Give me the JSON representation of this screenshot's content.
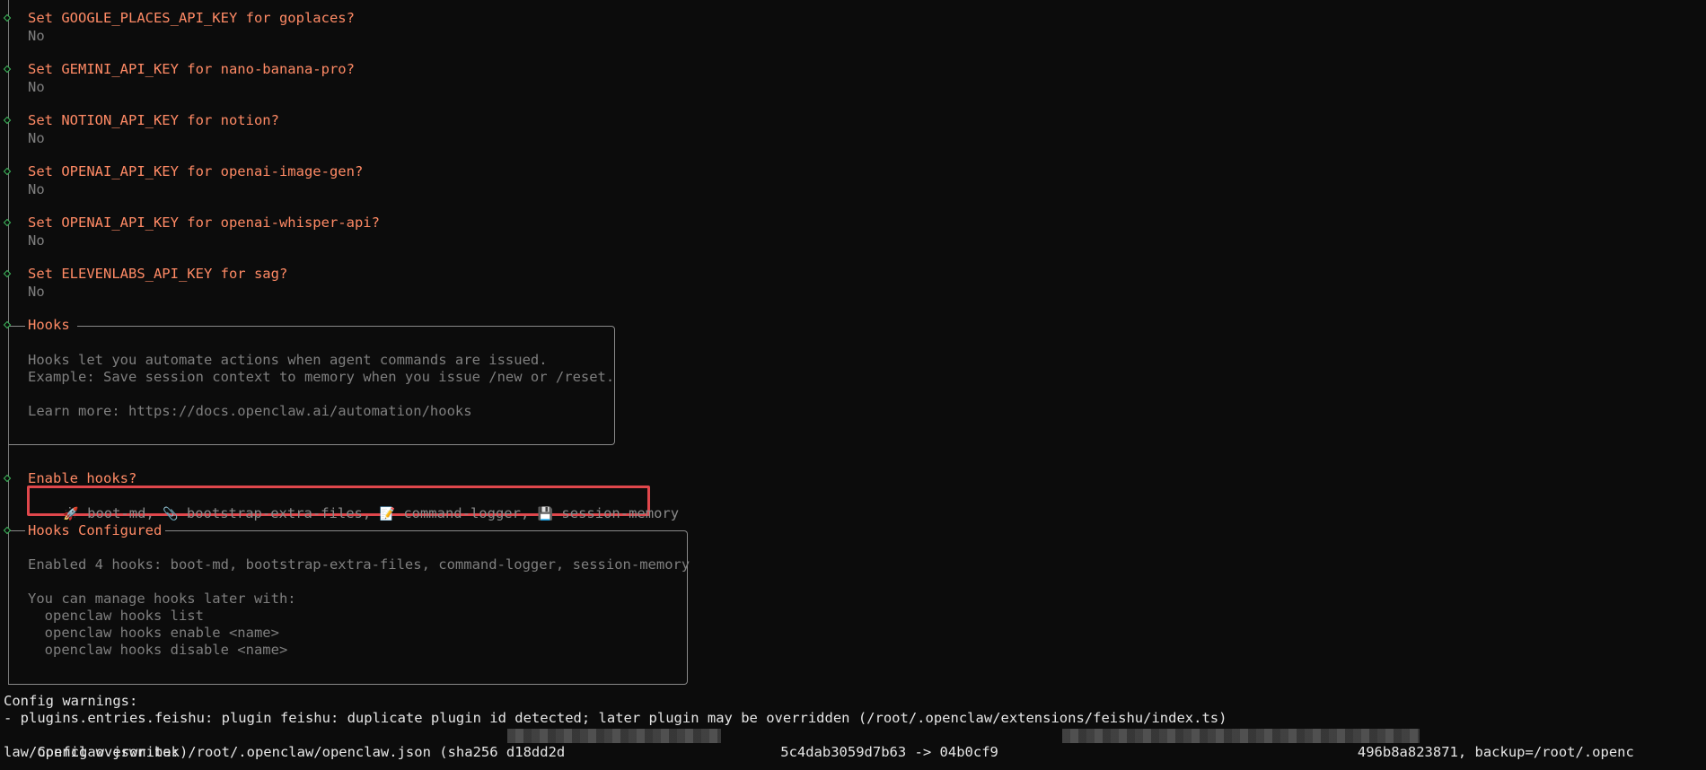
{
  "prompts": [
    {
      "question": "Set GOOGLE_PLACES_API_KEY for goplaces?",
      "answer": "No"
    },
    {
      "question": "Set GEMINI_API_KEY for nano-banana-pro?",
      "answer": "No"
    },
    {
      "question": "Set NOTION_API_KEY for notion?",
      "answer": "No"
    },
    {
      "question": "Set OPENAI_API_KEY for openai-image-gen?",
      "answer": "No"
    },
    {
      "question": "Set OPENAI_API_KEY for openai-whisper-api?",
      "answer": "No"
    },
    {
      "question": "Set ELEVENLABS_API_KEY for sag?",
      "answer": "No"
    }
  ],
  "hooks_box": {
    "title": "Hooks",
    "line1": "Hooks let you automate actions when agent commands are issued.",
    "line2": "Example: Save session context to memory when you issue /new or /reset.",
    "line3": "Learn more: https://docs.openclaw.ai/automation/hooks"
  },
  "enable_hooks": {
    "question": "Enable hooks?",
    "items": [
      {
        "icon": "🚀",
        "name": "boot-md"
      },
      {
        "icon": "📎",
        "name": "bootstrap-extra-files"
      },
      {
        "icon": "📝",
        "name": "command-logger"
      },
      {
        "icon": "💾",
        "name": "session-memory"
      }
    ],
    "separator": ", "
  },
  "hooks_configured": {
    "title": "Hooks Configured",
    "summary": "Enabled 4 hooks: boot-md, bootstrap-extra-files, command-logger, session-memory",
    "manage": "You can manage hooks later with:",
    "cmd1": "  openclaw hooks list",
    "cmd2": "  openclaw hooks enable <name>",
    "cmd3": "  openclaw hooks disable <name>"
  },
  "footer": {
    "warnings_header": "Config warnings:",
    "warning1": "- plugins.entries.feishu: plugin feishu: duplicate plugin id detected; later plugin may be overridden (/root/.openclaw/extensions/feishu/index.ts)",
    "overwrite_a": "Config overwrite: /root/.openclaw/openclaw.json (sha256 d18dd2d",
    "overwrite_b": "5c4dab3059d7b63 -> 04b0cf9",
    "overwrite_c": "496b8a823871, backup=/root/.openc",
    "overwrite_wrap": "law/openclaw.json.bak)"
  },
  "colors": {
    "background": "#0c0c0c",
    "prompt_orange": "#ff8a65",
    "diamond_green": "#3fbf5f",
    "dim_text": "#858585",
    "highlight_red": "#e0474c"
  }
}
